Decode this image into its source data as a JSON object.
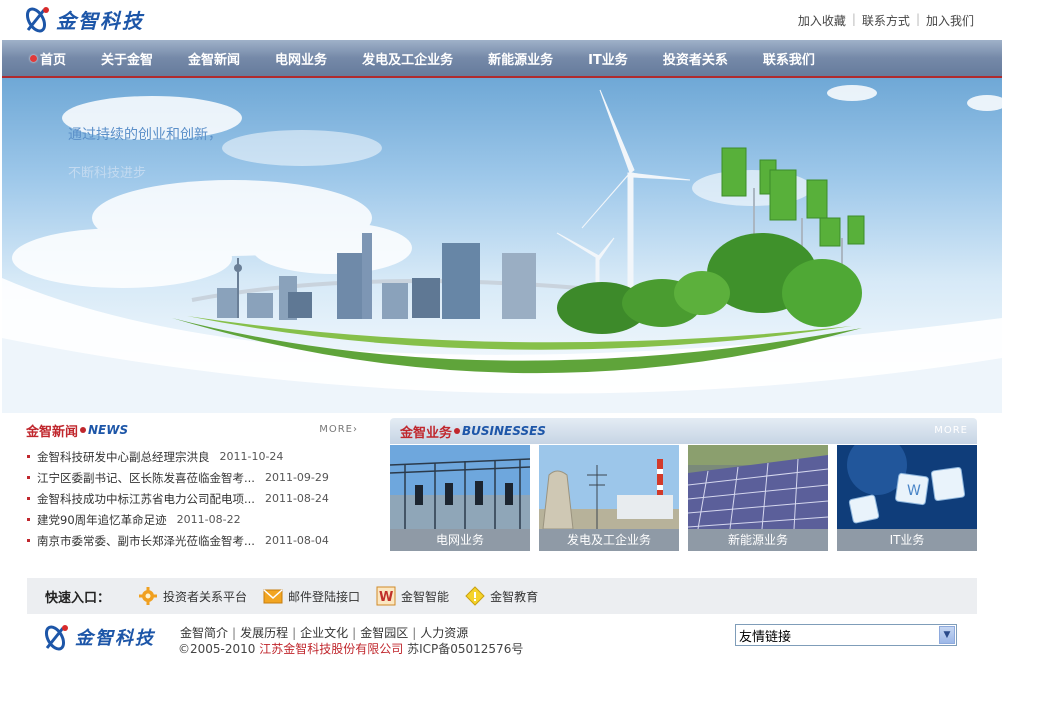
{
  "header": {
    "logo_text": "金智科技",
    "links": [
      "加入收藏",
      "联系方式",
      "加入我们"
    ]
  },
  "nav": {
    "items": [
      "首页",
      "关于金智",
      "金智新闻",
      "电网业务",
      "发电及工企业务",
      "新能源业务",
      "IT业务",
      "投资者关系",
      "联系我们"
    ]
  },
  "banner": {
    "slogan": "通过持续的创业和创新，",
    "slogan2": "不断科技进步"
  },
  "news": {
    "title_cn": "金智新闻",
    "title_en": "NEWS",
    "more": "MORE",
    "items": [
      {
        "title": "金智科技研发中心副总经理宗洪良",
        "date": "2011-10-24"
      },
      {
        "title": "江宁区委副书记、区长陈发喜莅临金智考...",
        "date": "2011-09-29"
      },
      {
        "title": "金智科技成功中标江苏省电力公司配电项...",
        "date": "2011-08-24"
      },
      {
        "title": "建党90周年追忆革命足迹",
        "date": "2011-08-22"
      },
      {
        "title": "南京市委常委、副市长郑泽光莅临金智考...",
        "date": "2011-08-04"
      }
    ]
  },
  "businesses": {
    "title_cn": "金智业务",
    "title_en": "BUSINESSES",
    "more": "MORE",
    "items": [
      {
        "label": "电网业务",
        "icon": "substation-photo"
      },
      {
        "label": "发电及工企业务",
        "icon": "power-plant-photo"
      },
      {
        "label": "新能源业务",
        "icon": "solar-panel-photo"
      },
      {
        "label": "IT业务",
        "icon": "it-cubes-photo"
      }
    ]
  },
  "quick": {
    "title": "快速入口：",
    "items": [
      {
        "label": "投资者关系平台",
        "icon": "gear-icon"
      },
      {
        "label": "邮件登陆接口",
        "icon": "mail-icon"
      },
      {
        "label": "金智智能",
        "icon": "w-logo-icon"
      },
      {
        "label": "金智教育",
        "icon": "diamond-icon"
      }
    ]
  },
  "footer": {
    "logo_text": "金智科技",
    "links": [
      "金智简介",
      "发展历程",
      "企业文化",
      "金智园区",
      "人力资源"
    ],
    "copyright": "©2005-2010",
    "company": "江苏金智科技股份有限公司",
    "icp": "苏ICP备05012576号",
    "select_value": "友情链接"
  },
  "colors": {
    "brand_blue": "#1d56a8",
    "accent_red": "#c0272d",
    "nav_bg": "#7589a8"
  }
}
